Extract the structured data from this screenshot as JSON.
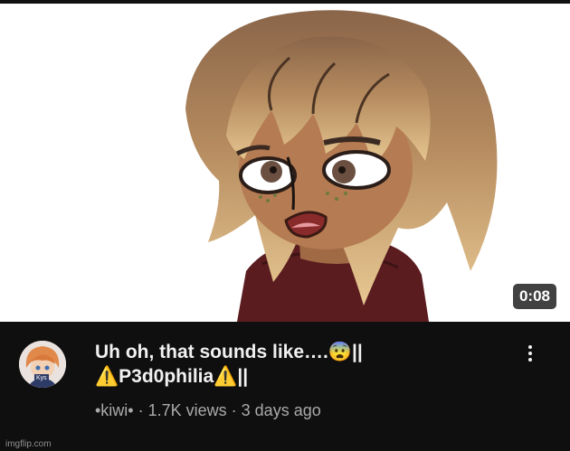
{
  "video": {
    "duration": "0:08",
    "title_line1": "Uh oh, that sounds like….😨||",
    "title_line2": "⚠️P3d0philia⚠️||",
    "channel": "•kiwi•",
    "views": "1.7K views",
    "age": "3 days ago",
    "meta_separator": " · "
  },
  "avatar": {
    "tag": "Kys"
  },
  "watermark": "imgflip.com",
  "colors": {
    "background": "#0f0f0f",
    "title": "#f1f1f1",
    "meta": "#aaaaaa"
  }
}
